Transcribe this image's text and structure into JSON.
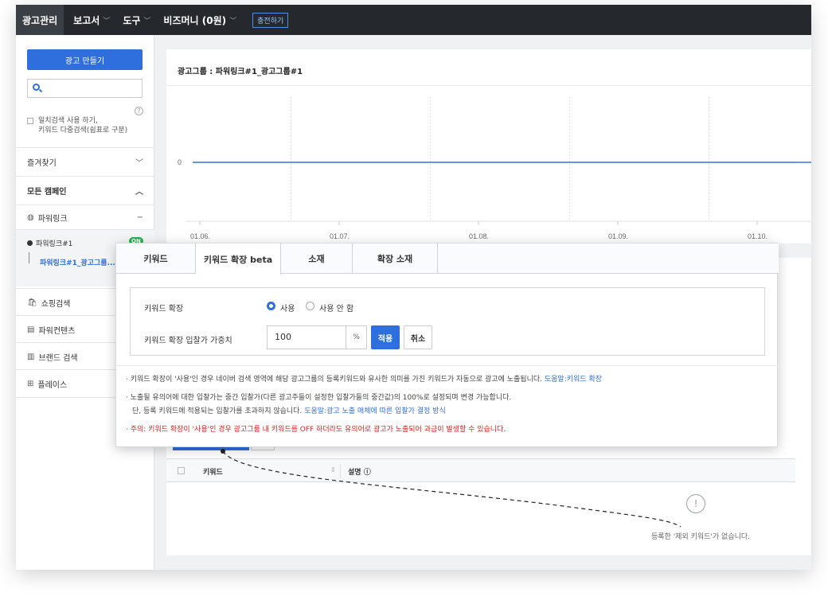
{
  "topnav": {
    "items": [
      {
        "label": "광고관리",
        "caret": ""
      },
      {
        "label": "보고서",
        "caret": "﹀"
      },
      {
        "label": "도구",
        "caret": "﹀"
      },
      {
        "label": "비즈머니 (0원)",
        "caret": "﹀"
      }
    ],
    "charge_label": "충전하기"
  },
  "sidebar": {
    "make_ad_label": "광고 만들기",
    "search_placeholder": "",
    "help_icon": "?",
    "checkbox_label_1": "일치검색 사용 하기,",
    "checkbox_label_2": "키워드 다중검색(쉼표로 구분)",
    "favorites": {
      "label": "즐겨찾기",
      "toggle": "﹀"
    },
    "all_campaigns": {
      "label": "모든 캠페인",
      "toggle": "︿"
    },
    "powerlink": {
      "icon": "globe-icon",
      "glyph": "◍",
      "label": "파워링크",
      "toggle": "−"
    },
    "campaign": {
      "label": "파워링크#1",
      "badge": "ON"
    },
    "adgroup": {
      "label": "파워링크#1_광고그룹..."
    },
    "others": [
      {
        "icon": "shopping-bag-icon",
        "glyph": "🛍",
        "label": "쇼핑검색"
      },
      {
        "icon": "content-icon",
        "glyph": "▤",
        "label": "파워컨텐츠"
      },
      {
        "icon": "brand-search-icon",
        "glyph": "▥",
        "label": "브랜드 검색"
      },
      {
        "icon": "place-icon",
        "glyph": "⊞",
        "label": "플레이스"
      }
    ]
  },
  "chart_panel": {
    "title": "광고그룹 : 파워링크#1_광고그룹#1"
  },
  "chart_data": {
    "type": "line",
    "x": [
      "01.06.",
      "01.07.",
      "01.08.",
      "01.09.",
      "01.10."
    ],
    "series": [
      {
        "values": [
          0,
          0,
          0,
          0,
          0
        ]
      }
    ],
    "yticks": [
      "0"
    ],
    "color": "#3b6fd8",
    "grid": "vertical dashed"
  },
  "popup": {
    "tabs": [
      "키워드",
      "키워드 확장 beta",
      "소재",
      "확장 소재"
    ],
    "active_tab": 1,
    "expand_label": "키워드 확장",
    "radio_use": "사용",
    "radio_nouse": "사용 안 함",
    "weight_label": "키워드 확장 입찰가 가중치",
    "weight_value": "100",
    "pct": "%",
    "apply_label": "적용",
    "cancel_label": "취소",
    "notes": {
      "n1_text": "· 키워드 확장이 '사용'인 경우 네이버 검색 영역에 해당 광고그룹의 등록키워드와 유사한 의미를 가진 키워드가 자동으로 광고에 노출됩니다.",
      "n1_link": "도움말:키워드 확장",
      "n2_text": "· 노출될 유의어에 대한 입찰가는 중간 입찰가(다른 광고주들이 설정한 입찰가들의 중간값)의 100%로 설정되며 변경 가능합니다.",
      "n3_text": "단, 등록 키워드에 적용되는 입찰가를 초과하지 않습니다.",
      "n3_link": "도움말:광고 노출 매체에 따른 입찰가 결정 방식",
      "n4_text": "· 주의: 키워드 확장이 '사용'인 경우 광고그룹 내 키워드를 OFF 하더라도 유의어로 광고가 노출되어 과금이 발생할 수 있습니다."
    }
  },
  "table": {
    "col_keyword": "키워드",
    "sort_glyph": "⇕",
    "col_desc": "설명 ⓘ",
    "empty_glyph": "!",
    "empty_text": "등록한 '제외 키워드'가 없습니다."
  }
}
